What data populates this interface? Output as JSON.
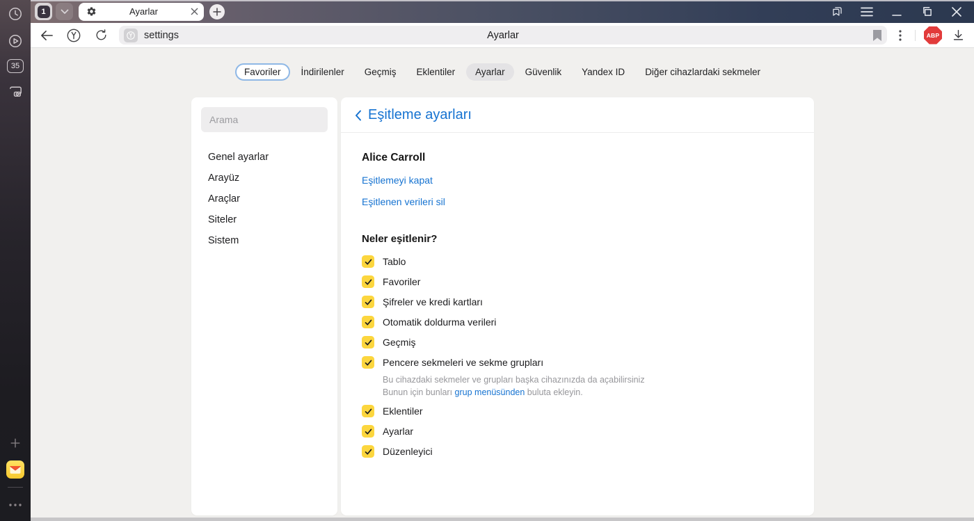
{
  "window": {
    "tab_count": "1",
    "tab_title": "Ayarlar",
    "url_text": "settings",
    "page_title": "Ayarlar",
    "adblock_badge": "ABP",
    "rail_counter": "35"
  },
  "nav_tabs": [
    {
      "label": "Favoriler",
      "state": "outlined"
    },
    {
      "label": "İndirilenler",
      "state": "normal"
    },
    {
      "label": "Geçmiş",
      "state": "normal"
    },
    {
      "label": "Eklentiler",
      "state": "normal"
    },
    {
      "label": "Ayarlar",
      "state": "active"
    },
    {
      "label": "Güvenlik",
      "state": "normal"
    },
    {
      "label": "Yandex ID",
      "state": "normal"
    },
    {
      "label": "Diğer cihazlardaki sekmeler",
      "state": "normal"
    }
  ],
  "settings_sidebar": {
    "search_placeholder": "Arama",
    "items": [
      "Genel ayarlar",
      "Arayüz",
      "Araçlar",
      "Siteler",
      "Sistem"
    ]
  },
  "sync_panel": {
    "title": "Eşitleme ayarları",
    "account_name": "Alice Carroll",
    "link_disable_sync": "Eşitlemeyi kapat",
    "link_delete_synced": "Eşitlenen verileri sil",
    "section_title": "Neler eşitlenir?",
    "items": [
      {
        "label": "Tablo",
        "checked": true
      },
      {
        "label": "Favoriler",
        "checked": true
      },
      {
        "label": "Şifreler ve kredi kartları",
        "checked": true
      },
      {
        "label": "Otomatik doldurma verileri",
        "checked": true
      },
      {
        "label": "Geçmiş",
        "checked": true
      },
      {
        "label": "Pencere sekmeleri ve sekme grupları",
        "checked": true,
        "description_line1": "Bu cihazdaki sekmeler ve grupları başka cihazınızda da açabilirsiniz",
        "description_line2_prefix": "Bunun için bunları ",
        "description_link": "grup menüsünden",
        "description_line2_suffix": " buluta ekleyin."
      },
      {
        "label": "Eklentiler",
        "checked": true
      },
      {
        "label": "Ayarlar",
        "checked": true
      },
      {
        "label": "Düzenleyici",
        "checked": true
      }
    ]
  },
  "colors": {
    "accent_blue": "#1673d1",
    "checkbox_yellow": "#fcd63e",
    "adblock_red": "#e23b3b"
  }
}
